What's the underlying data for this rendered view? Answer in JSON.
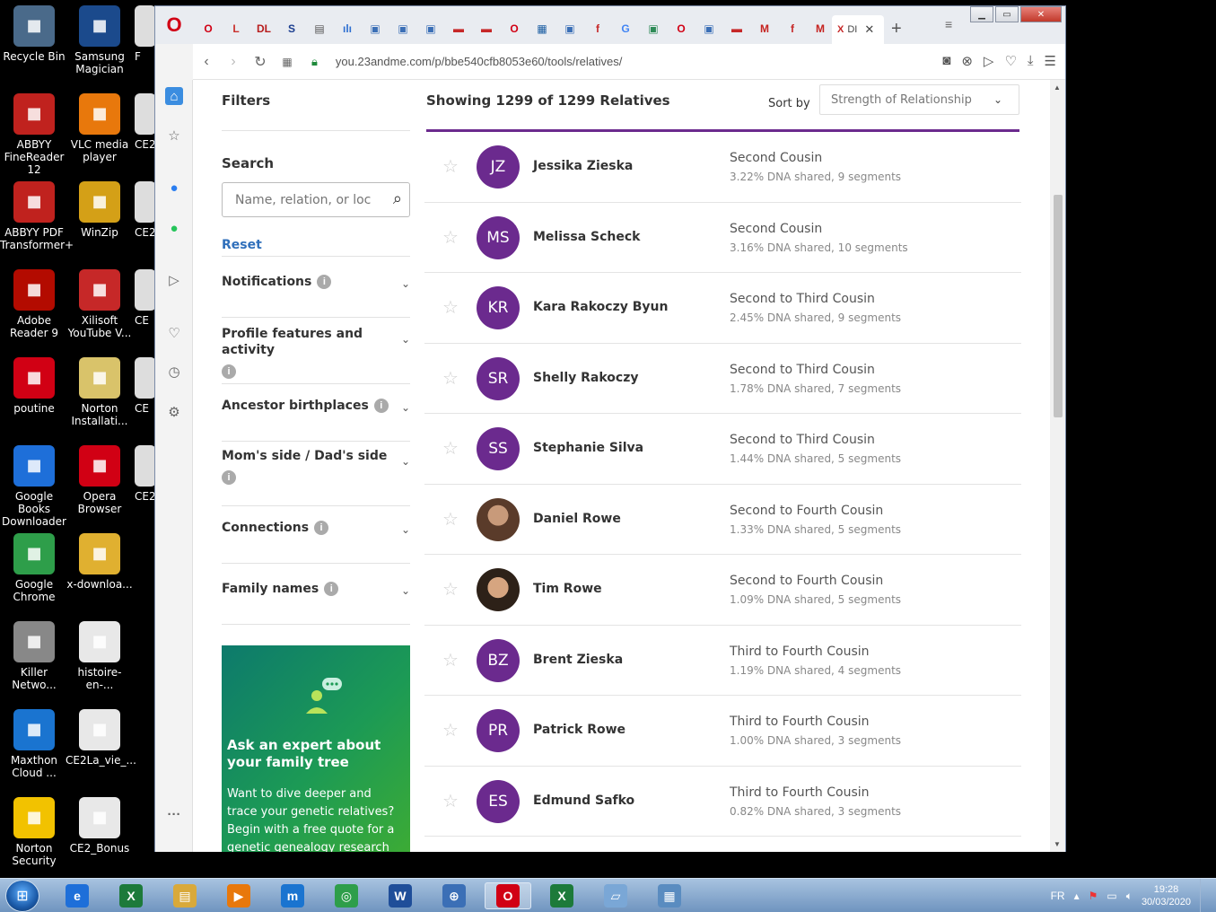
{
  "desktop_icons": [
    {
      "label": "Recycle Bin",
      "icon": "recycle-bin-icon",
      "color": "#4a6a8a"
    },
    {
      "label": "Samsung Magician",
      "icon": "samsung-magician-icon",
      "color": "#1b4a8c"
    },
    {
      "label": "ABBYY FineReader 12",
      "icon": "abbyy-finereader-icon",
      "color": "#c0221e"
    },
    {
      "label": "VLC media player",
      "icon": "vlc-icon",
      "color": "#e8780c"
    },
    {
      "label": "ABBYY PDF Transformer+",
      "icon": "abbyy-pdf-icon",
      "color": "#c0221e"
    },
    {
      "label": "WinZip",
      "icon": "winzip-icon",
      "color": "#d4a017"
    },
    {
      "label": "Adobe Reader 9",
      "icon": "adobe-reader-icon",
      "color": "#b30b00"
    },
    {
      "label": "Xilisoft YouTube V...",
      "icon": "xilisoft-icon",
      "color": "#c62828"
    },
    {
      "label": "poutine",
      "icon": "opera-icon",
      "color": "#d10014"
    },
    {
      "label": "Norton Installati...",
      "icon": "norton-installer-icon",
      "color": "#d9c36a"
    },
    {
      "label": "Google Books Downloader",
      "icon": "google-books-icon",
      "color": "#1e6fd9"
    },
    {
      "label": "Opera Browser",
      "icon": "opera-icon",
      "color": "#d10014"
    },
    {
      "label": "Google Chrome",
      "icon": "chrome-icon",
      "color": "#2e9e4a"
    },
    {
      "label": "x-downloa...",
      "icon": "x-downloader-icon",
      "color": "#e0b030"
    },
    {
      "label": "Killer Netwo...",
      "icon": "killer-network-icon",
      "color": "#888888"
    },
    {
      "label": "histoire-en-...",
      "icon": "pdf-file-icon",
      "color": "#e8e8e8"
    },
    {
      "label": "Maxthon Cloud ...",
      "icon": "maxthon-icon",
      "color": "#1a74d0"
    },
    {
      "label": "CE2La_vie_...",
      "icon": "document-file-icon",
      "color": "#e8e8e8"
    },
    {
      "label": "Norton Security",
      "icon": "norton-security-icon",
      "color": "#f2c200"
    },
    {
      "label": "CE2_Bonus",
      "icon": "pdf-file-icon",
      "color": "#e8e8e8"
    }
  ],
  "desktop_partial": [
    "F",
    "CE2_",
    "CE2",
    "CE",
    "CE",
    "CE2"
  ],
  "browser": {
    "url": "you.23andme.com/p/bbe540cfb8053e60/tools/relatives/",
    "active_tab_label": "DI",
    "tab_icons": [
      "O",
      "L",
      "DL",
      "S",
      "▤",
      "ılı",
      "▣",
      "▣",
      "▣",
      "▬",
      "▬",
      "O",
      "▦",
      "▣",
      "f",
      "G",
      "▣",
      "O",
      "▣",
      "▬",
      "M",
      "f",
      "M"
    ],
    "tab_colors": [
      "#d10014",
      "#c9302c",
      "#b71c1c",
      "#1a3d8f",
      "#555555",
      "#2e6fd1",
      "#3b6fb6",
      "#3b6fb6",
      "#3b6fb6",
      "#c62828",
      "#c62828",
      "#d10014",
      "#1d5fa3",
      "#3b6fb6",
      "#c62828",
      "#4285f4",
      "#2e8b57",
      "#d10014",
      "#3b6fb6",
      "#c62828",
      "#c5221f",
      "#c62828",
      "#c5221f"
    ]
  },
  "page": {
    "filters": {
      "title": "Filters",
      "search_label": "Search",
      "search_placeholder": "Name, relation, or loc",
      "reset_label": "Reset",
      "sections": [
        {
          "label": "Notifications",
          "line2": ""
        },
        {
          "label": "Profile features and activity",
          "line2": ""
        },
        {
          "label": "Ancestor birthplaces",
          "line2": ""
        },
        {
          "label": "Mom's side / Dad's side",
          "line2": ""
        },
        {
          "label": "Connections",
          "line2": ""
        },
        {
          "label": "Family names",
          "line2": ""
        }
      ]
    },
    "promo": {
      "title": "Ask an expert about your family tree",
      "body": "Want to dive deeper and trace your genetic relatives? Begin with a free quote for a genetic genealogy research package"
    },
    "results_heading": "Showing 1299 of 1299 Relatives",
    "sort_label": "Sort by",
    "sort_value": "Strength of Relationship",
    "relatives": [
      {
        "initials": "JZ",
        "name": "Jessika Zieska",
        "relation": "Second Cousin",
        "dna": "3.22% DNA shared, 9 segments",
        "photo": false
      },
      {
        "initials": "MS",
        "name": "Melissa Scheck",
        "relation": "Second Cousin",
        "dna": "3.16% DNA shared, 10 segments",
        "photo": false
      },
      {
        "initials": "KR",
        "name": "Kara Rakoczy Byun",
        "relation": "Second to Third Cousin",
        "dna": "2.45% DNA shared, 9 segments",
        "photo": false
      },
      {
        "initials": "SR",
        "name": "Shelly Rakoczy",
        "relation": "Second to Third Cousin",
        "dna": "1.78% DNA shared, 7 segments",
        "photo": false
      },
      {
        "initials": "SS",
        "name": "Stephanie Silva",
        "relation": "Second to Third Cousin",
        "dna": "1.44% DNA shared, 5 segments",
        "photo": false
      },
      {
        "initials": "",
        "name": "Daniel Rowe",
        "relation": "Second to Fourth Cousin",
        "dna": "1.33% DNA shared, 5 segments",
        "photo": true
      },
      {
        "initials": "",
        "name": "Tim Rowe",
        "relation": "Second to Fourth Cousin",
        "dna": "1.09% DNA shared, 5 segments",
        "photo": true
      },
      {
        "initials": "BZ",
        "name": "Brent Zieska",
        "relation": "Third to Fourth Cousin",
        "dna": "1.19% DNA shared, 4 segments",
        "photo": false
      },
      {
        "initials": "PR",
        "name": "Patrick Rowe",
        "relation": "Third to Fourth Cousin",
        "dna": "1.00% DNA shared, 3 segments",
        "photo": false
      },
      {
        "initials": "ES",
        "name": "Edmund Safko",
        "relation": "Third to Fourth Cousin",
        "dna": "0.82% DNA shared, 3 segments",
        "photo": false
      }
    ]
  },
  "taskbar": {
    "apps": [
      {
        "icon": "internet-explorer-icon",
        "glyph": "e",
        "color": "#1e6fd9"
      },
      {
        "icon": "excel-icon",
        "glyph": "X",
        "color": "#1d7a3a"
      },
      {
        "icon": "file-explorer-icon",
        "glyph": "▤",
        "color": "#d9a93a"
      },
      {
        "icon": "media-player-icon",
        "glyph": "▶",
        "color": "#e8780c"
      },
      {
        "icon": "maxthon-icon",
        "glyph": "m",
        "color": "#1a74d0"
      },
      {
        "icon": "chrome-icon",
        "glyph": "◎",
        "color": "#2e9e4a"
      },
      {
        "icon": "word-icon",
        "glyph": "W",
        "color": "#1f4e99"
      },
      {
        "icon": "remote-icon",
        "glyph": "⊕",
        "color": "#3b6fb6"
      },
      {
        "icon": "opera-icon",
        "glyph": "O",
        "color": "#d10014"
      },
      {
        "icon": "excel-icon",
        "glyph": "X",
        "color": "#1d7a3a"
      },
      {
        "icon": "notepad-icon",
        "glyph": "▱",
        "color": "#7aa7d6"
      },
      {
        "icon": "picture-viewer-icon",
        "glyph": "▦",
        "color": "#5a8cc0"
      }
    ],
    "language": "FR",
    "time": "19:28",
    "date": "30/03/2020"
  }
}
